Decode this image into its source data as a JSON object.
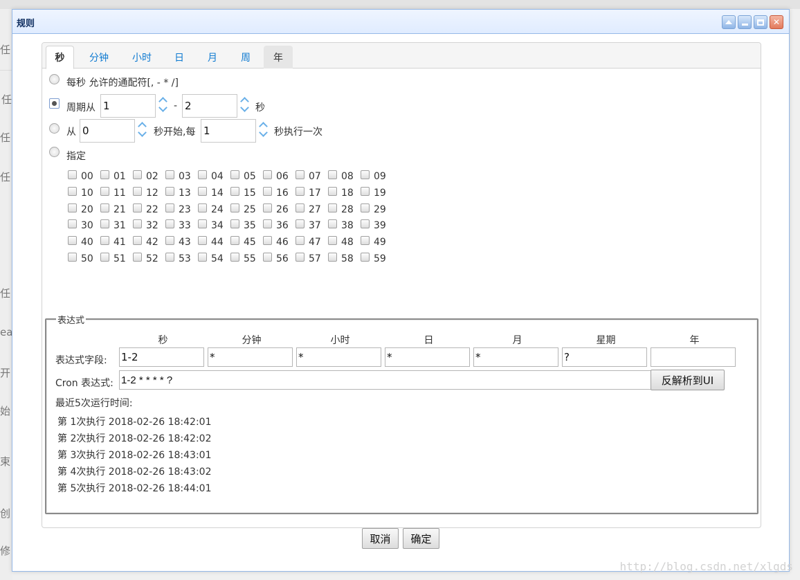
{
  "background": {
    "labels": [
      "任",
      "任",
      "任",
      "任",
      "任",
      "ea",
      "开",
      "始",
      "束",
      "创",
      "修"
    ]
  },
  "window": {
    "title": "规则",
    "tools": [
      "collapse",
      "minimize",
      "maximize",
      "close"
    ]
  },
  "tabs": [
    "秒",
    "分钟",
    "小时",
    "日",
    "月",
    "周",
    "年"
  ],
  "active_tab": "秒",
  "options": {
    "every": "每秒 允许的通配符[, - * /]",
    "cycle_prefix": "周期从",
    "cycle_from": "1",
    "cycle_dash": "-",
    "cycle_to": "2",
    "cycle_suffix": "秒",
    "start_prefix": "从",
    "start_value": "0",
    "start_middle": "秒开始,每",
    "start_step": "1",
    "start_suffix": "秒执行一次",
    "specify": "指定"
  },
  "selected_option": "cycle",
  "seconds": [
    "00",
    "01",
    "02",
    "03",
    "04",
    "05",
    "06",
    "07",
    "08",
    "09",
    "10",
    "11",
    "12",
    "13",
    "14",
    "15",
    "16",
    "17",
    "18",
    "19",
    "20",
    "21",
    "22",
    "23",
    "24",
    "25",
    "26",
    "27",
    "28",
    "29",
    "30",
    "31",
    "32",
    "33",
    "34",
    "35",
    "36",
    "37",
    "38",
    "39",
    "40",
    "41",
    "42",
    "43",
    "44",
    "45",
    "46",
    "47",
    "48",
    "49",
    "50",
    "51",
    "52",
    "53",
    "54",
    "55",
    "56",
    "57",
    "58",
    "59"
  ],
  "expression": {
    "legend": "表达式",
    "columns": [
      "秒",
      "分钟",
      "小时",
      "日",
      "月",
      "星期",
      "年"
    ],
    "fields_label": "表达式字段:",
    "fields": [
      "1-2",
      "*",
      "*",
      "*",
      "*",
      "?",
      ""
    ],
    "cron_label": "Cron 表达式:",
    "cron_value": "1-2 * * * * ?",
    "parse_button": "反解析到UI",
    "recent_label": "最近5次运行时间:",
    "runs": [
      "第 1次执行 2018-02-26 18:42:01",
      "第 2次执行 2018-02-26 18:42:02",
      "第 3次执行 2018-02-26 18:43:01",
      "第 4次执行 2018-02-26 18:43:02",
      "第 5次执行 2018-02-26 18:44:01"
    ]
  },
  "buttons": {
    "cancel": "取消",
    "ok": "确定"
  },
  "watermark": "http://blog.csdn.net/xlgds"
}
